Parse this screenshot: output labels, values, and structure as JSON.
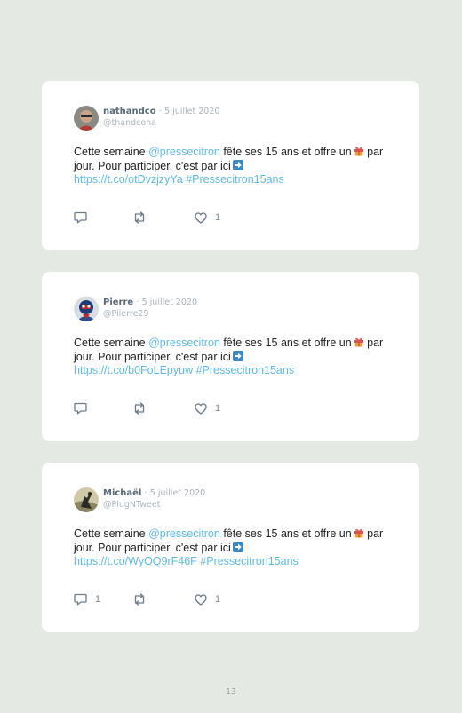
{
  "tweets": [
    {
      "author_name": "nathandco",
      "separator": "·",
      "date": "5 juillet 2020",
      "handle": "@thandcona",
      "text_before": "Cette semaine ",
      "mention": "@pressecitron",
      "text_middle": " fête ses 15 ans et offre un",
      "text_after": " par jour. Pour participer, c'est par ici",
      "url": "https://t.co/otDvzjzyYa",
      "hashtag": "#Pressecitron15ans",
      "reply_count": "",
      "retweet_count": "",
      "like_count": "1"
    },
    {
      "author_name": "Pierre",
      "separator": "·",
      "date": "5 juillet 2020",
      "handle": "@Piierre29",
      "text_before": "Cette semaine ",
      "mention": "@pressecitron",
      "text_middle": " fête ses 15 ans et offre un",
      "text_after": " par jour. Pour participer, c'est par ici",
      "url": "https://t.co/b0FoLEpyuw",
      "hashtag": "#Pressecitron15ans",
      "reply_count": "",
      "retweet_count": "",
      "like_count": "1"
    },
    {
      "author_name": "Michaël",
      "separator": "·",
      "date": "5 juillet 2020",
      "handle": "@PlugNTweet",
      "text_before": "Cette semaine ",
      "mention": "@pressecitron",
      "text_middle": " fête ses 15 ans et offre un",
      "text_after": " par jour. Pour participer, c'est par ici",
      "url": "https://t.co/WyOQ9rF46F",
      "hashtag": "#Pressecitron15ans",
      "reply_count": "1",
      "retweet_count": "",
      "like_count": "1"
    }
  ],
  "page_number": "13",
  "colors": {
    "background": "#e5e9e3",
    "card": "#ffffff",
    "link": "#5dbbea",
    "icon": "#6b7b8a"
  },
  "icons": [
    "reply-icon",
    "retweet-icon",
    "like-icon",
    "gift-emoji-icon",
    "arrow-right-emoji-icon"
  ]
}
